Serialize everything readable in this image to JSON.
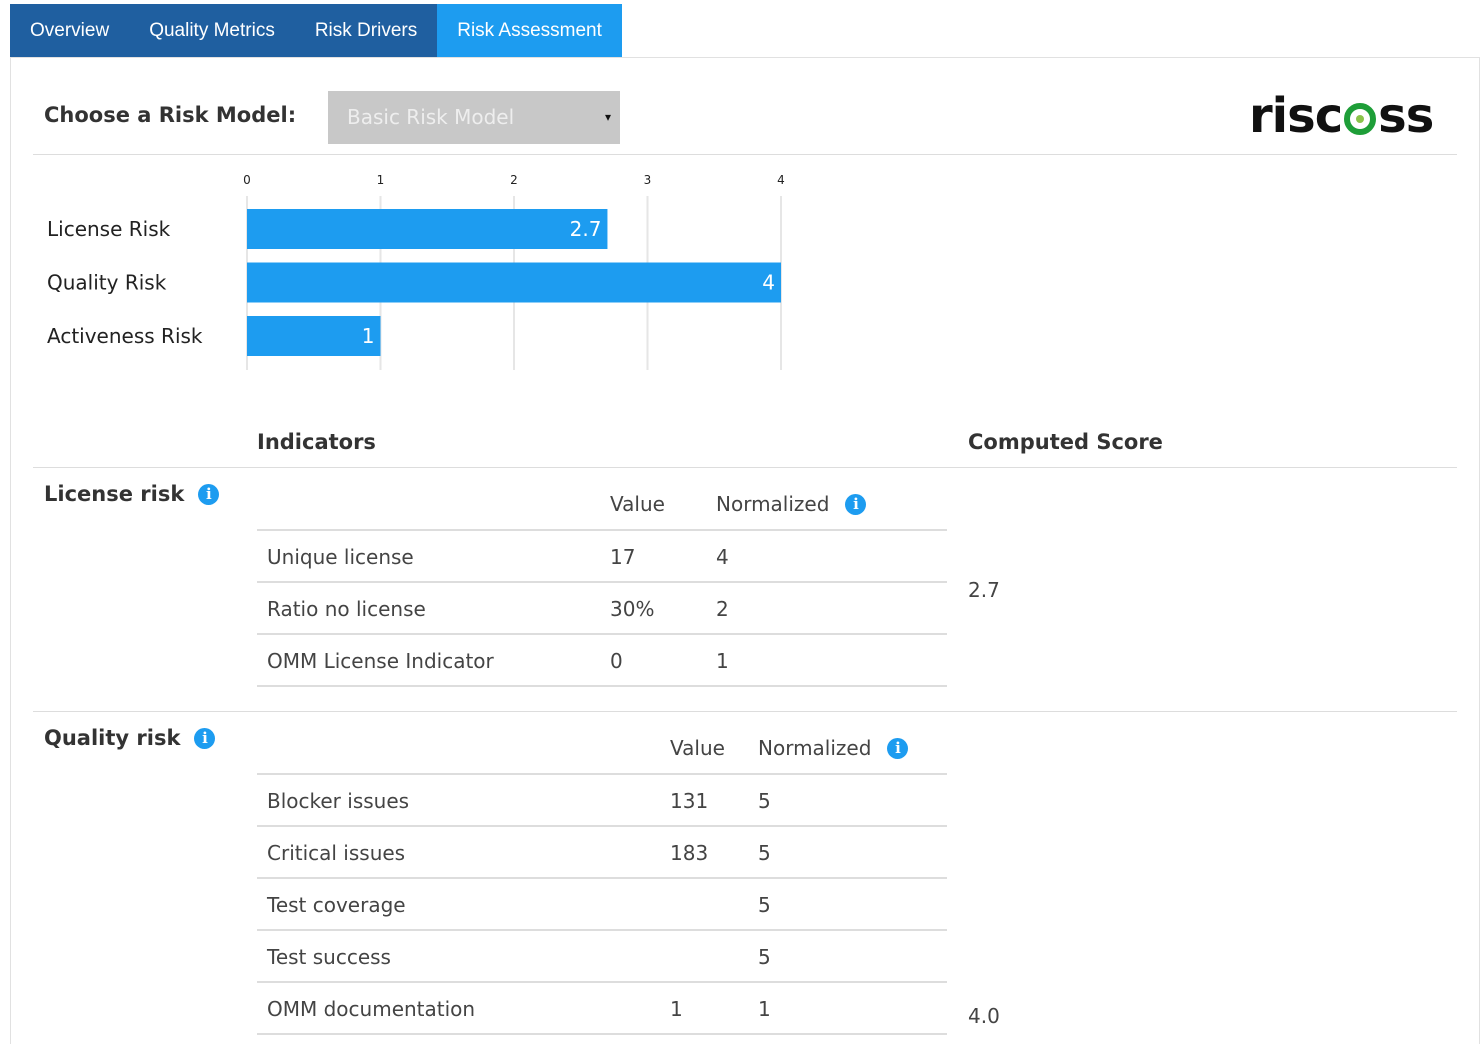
{
  "tabs": [
    {
      "label": "Overview",
      "active": false
    },
    {
      "label": "Quality Metrics",
      "active": false
    },
    {
      "label": "Risk Drivers",
      "active": false
    },
    {
      "label": "Risk Assessment",
      "active": true
    }
  ],
  "model_selector": {
    "label": "Choose a Risk Model:",
    "selected": "Basic Risk Model",
    "caret": "▾"
  },
  "logo": {
    "text_before": "risc",
    "text_after": "ss"
  },
  "chart_data": {
    "type": "bar",
    "orientation": "horizontal",
    "categories": [
      "License Risk",
      "Quality Risk",
      "Activeness Risk"
    ],
    "values": [
      2.7,
      4,
      1
    ],
    "data_labels": [
      "2.7",
      "4",
      "1"
    ],
    "ticks": [
      "0",
      "1",
      "2",
      "3",
      "4"
    ],
    "xlim": [
      0,
      4
    ],
    "grid": true,
    "bar_color": "#1d9cf0"
  },
  "table": {
    "indicators_header": "Indicators",
    "score_header": "Computed Score",
    "value_header": "Value",
    "normalized_header": "Normalized",
    "groups": [
      {
        "name": "License risk",
        "score": "2.7",
        "rows": [
          {
            "indicator": "Unique license",
            "value": "17",
            "normalized": "4"
          },
          {
            "indicator": "Ratio no license",
            "value": "30%",
            "normalized": "2"
          },
          {
            "indicator": "OMM License Indicator",
            "value": "0",
            "normalized": "1"
          }
        ]
      },
      {
        "name": "Quality risk",
        "score": "4.0",
        "rows": [
          {
            "indicator": "Blocker issues",
            "value": "131",
            "normalized": "5"
          },
          {
            "indicator": "Critical issues",
            "value": "183",
            "normalized": "5"
          },
          {
            "indicator": "Test coverage",
            "value": "",
            "normalized": "5"
          },
          {
            "indicator": "Test success",
            "value": "",
            "normalized": "5"
          },
          {
            "indicator": "OMM documentation",
            "value": "1",
            "normalized": "1"
          }
        ]
      }
    ]
  },
  "icons": {
    "info": "info-icon",
    "info_glyph": "i"
  },
  "colors": {
    "tab_bar": "#1f5fa0",
    "tab_active": "#1d9cf0",
    "accent": "#1d9cf0",
    "logo_green": "#1e9e38"
  }
}
